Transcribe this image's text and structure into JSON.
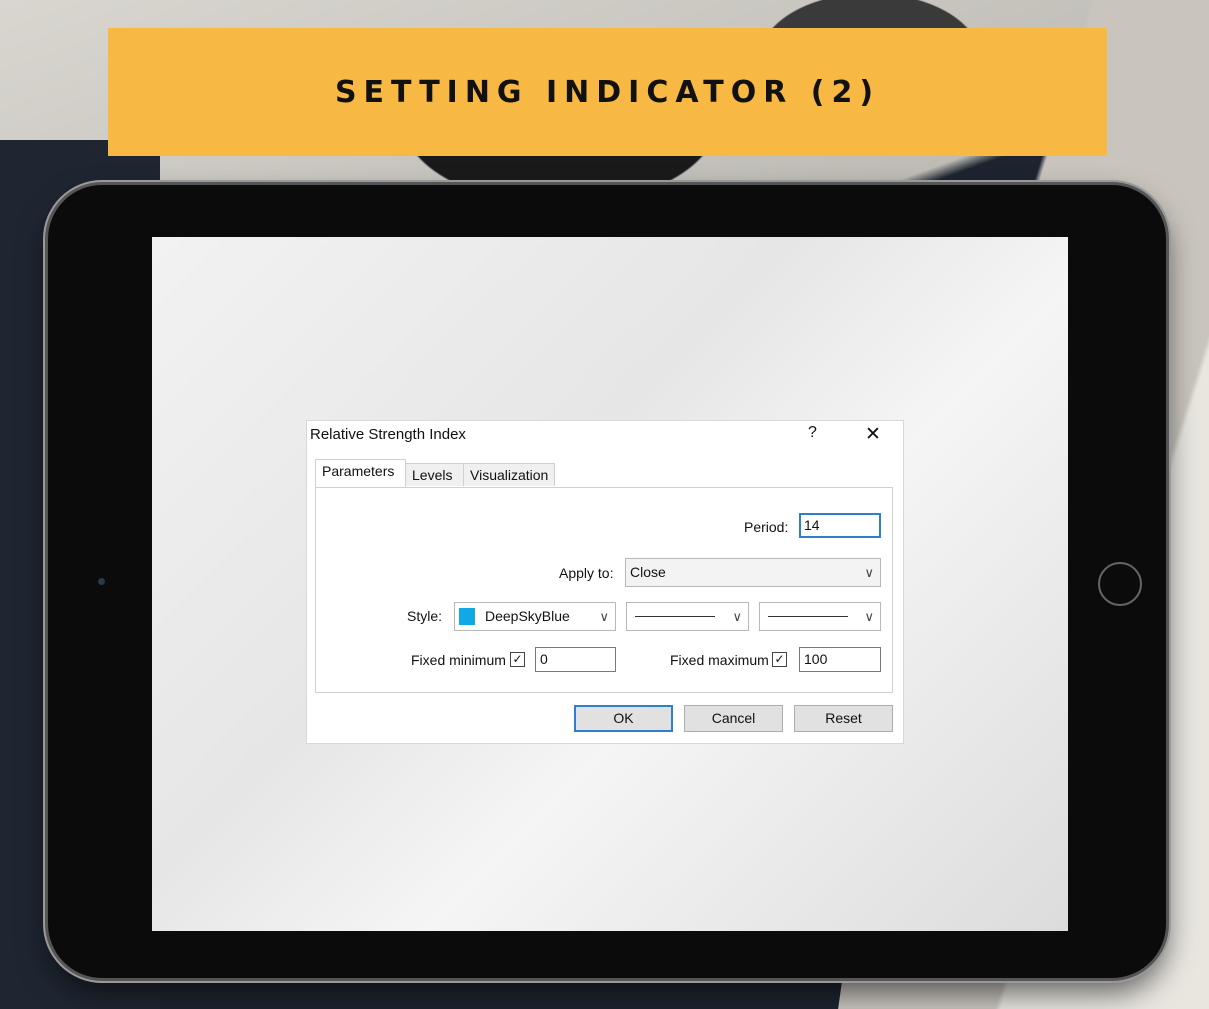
{
  "banner": {
    "title": "SETTING INDICATOR (2)"
  },
  "dialog": {
    "title": "Relative Strength Index",
    "help_label": "?",
    "close_label": "✕",
    "tabs": [
      {
        "label": "Parameters",
        "active": true
      },
      {
        "label": "Levels",
        "active": false
      },
      {
        "label": "Visualization",
        "active": false
      }
    ],
    "period": {
      "label": "Period:",
      "value": "14"
    },
    "apply_to": {
      "label": "Apply to:",
      "value": "Close"
    },
    "style": {
      "label": "Style:",
      "color_name": "DeepSkyBlue",
      "color_hex": "#10a9e6"
    },
    "fixed_minimum": {
      "label": "Fixed minimum",
      "checked": true,
      "value": "0"
    },
    "fixed_maximum": {
      "label": "Fixed maximum",
      "checked": true,
      "value": "100"
    },
    "buttons": {
      "ok": "OK",
      "cancel": "Cancel",
      "reset": "Reset"
    }
  },
  "colors": {
    "banner": "#f7b844",
    "focus": "#2f7fd0",
    "swatch": "#10a9e6"
  }
}
